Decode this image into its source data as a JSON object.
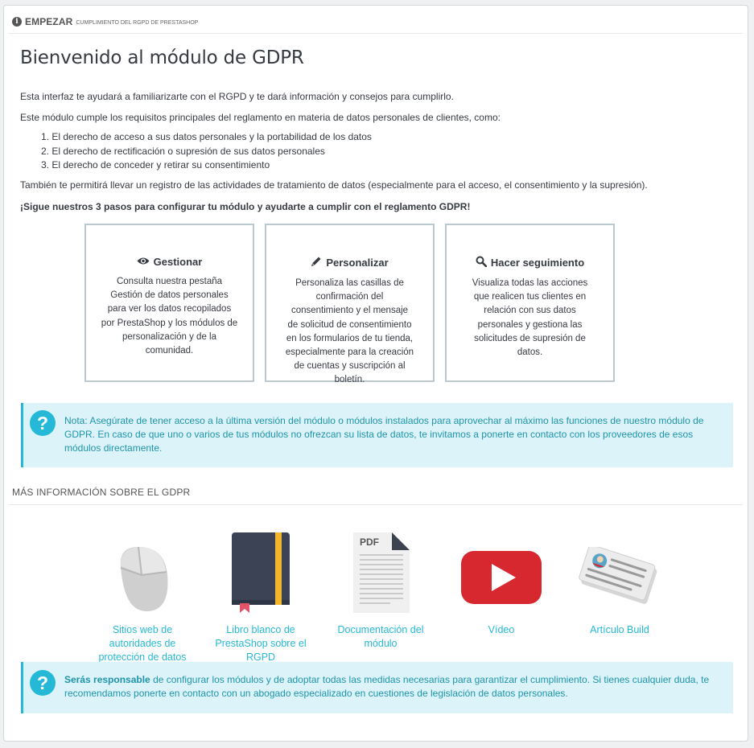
{
  "header": {
    "title": "EMPEZAR",
    "subtitle": "CUMPLIMIENTO DEL RGPD DE PRESTASHOP"
  },
  "main": {
    "heading": "Bienvenido al módulo de GDPR",
    "intro": "Esta interfaz te ayudará a familiarizarte con el RGPD y te dará información y consejos para cumplirlo.",
    "requirements_intro": "Este módulo cumple los requisitos principales del reglamento en materia de datos personales de clientes, como:",
    "rights": [
      "1. El derecho de acceso a sus datos personales y la portabilidad de los datos",
      "2. El derecho de rectificación o supresión de sus datos personales",
      "3. El derecho de conceder y retirar su consentimiento"
    ],
    "register_note": "También te permitirá llevar un registro de las actividades de tratamiento de datos (especialmente para el acceso, el consentimiento y la supresión).",
    "steps_intro": "¡Sigue nuestros 3 pasos para configurar tu módulo y ayudarte a cumplir con el reglamento GDPR!",
    "steps": [
      {
        "icon": "eye-icon",
        "title": "Gestionar",
        "text": "Consulta nuestra pestaña Gestión de datos personales para ver los datos recopilados por PrestaShop y los módulos de personalización y de la comunidad."
      },
      {
        "icon": "pencil-icon",
        "title": "Personalizar",
        "text": "Personaliza las casillas de confirmación del consentimiento y el mensaje de solicitud de consentimiento en los formularios de tu tienda, especialmente para la creación de cuentas y suscripción al boletín."
      },
      {
        "icon": "search-icon",
        "title": "Hacer seguimiento",
        "text": "Visualiza todas las acciones que realicen tus clientes en relación con sus datos personales y gestiona las solicitudes de supresión de datos."
      }
    ],
    "note": "Nota: Asegúrate de tener acceso a la última versión del módulo o módulos instalados para aprovechar al máximo las funciones de nuestro módulo de GDPR. En caso de que uno o varios de tus módulos no ofrezcan su lista de datos, te invitamos a ponerte en contacto con los proveedores de esos módulos directamente."
  },
  "more_info": {
    "title": "MÁS INFORMACIÓN SOBRE EL GDPR",
    "resources": [
      {
        "icon": "mouse-icon",
        "label": "Sitios web de autoridades de protección de datos"
      },
      {
        "icon": "book-icon",
        "label": "Libro blanco de PrestaShop sobre el RGPD"
      },
      {
        "icon": "pdf-icon",
        "label": "Documentación del módulo"
      },
      {
        "icon": "video-play-icon",
        "label": "Vídeo"
      },
      {
        "icon": "newspaper-icon",
        "label": "Artículo Build"
      }
    ],
    "responsibility_bold": "Serás responsable",
    "responsibility_text": " de configurar los módulos y de adoptar todas las medidas necesarias para garantizar el cumplimiento. Si tienes cualquier duda, te recomendamos ponerte en contacto con un abogado especializado en cuestiones de legislación de datos personales."
  },
  "colors": {
    "accent": "#25b9d7",
    "alert_bg": "#dcf4f9",
    "text": "#363a41"
  }
}
